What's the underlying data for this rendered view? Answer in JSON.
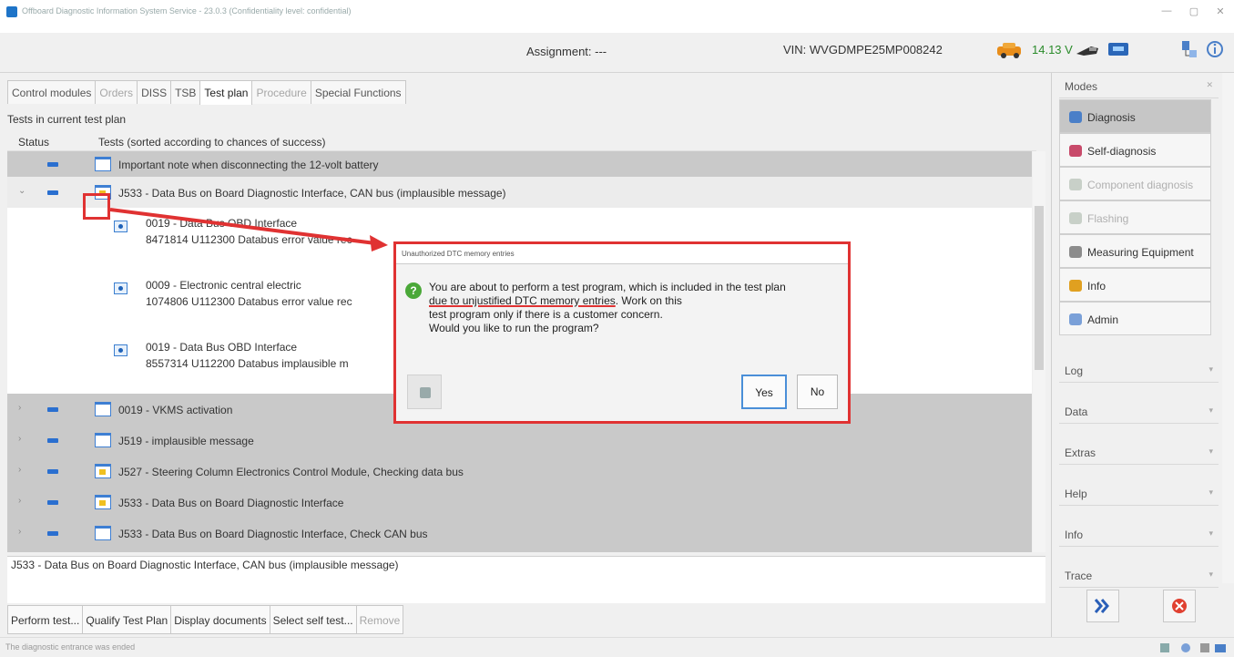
{
  "window": {
    "title": "Offboard Diagnostic Information System Service - 23.0.3 (Confidentiality level: confidential)",
    "minimize": "—",
    "maximize": "▢",
    "close": "✕"
  },
  "infobar": {
    "assignment": "Assignment: ---",
    "vin": "VIN: WVGDMPE25MP008242",
    "voltage": "14.13 V"
  },
  "tabs": [
    {
      "label": "Control modules",
      "state": "normal"
    },
    {
      "label": "Orders",
      "state": "dim"
    },
    {
      "label": "DISS",
      "state": "normal"
    },
    {
      "label": "TSB",
      "state": "normal"
    },
    {
      "label": "Test plan",
      "state": "active"
    },
    {
      "label": "Procedure",
      "state": "dim"
    },
    {
      "label": "Special Functions",
      "state": "normal"
    }
  ],
  "testplan": {
    "section_title": "Tests in current test plan",
    "col_status": "Status",
    "col_tests": "Tests (sorted according to chances of success)",
    "rows": [
      {
        "label": "Important note when disconnecting the 12-volt battery"
      },
      {
        "label": "J533 - Data Bus on Board Diagnostic Interface, CAN bus (implausible message)"
      },
      {
        "label": "0019 - VKMS activation"
      },
      {
        "label": "J519 - implausible message"
      },
      {
        "label": "J527 - Steering Column Electronics Control Module, Checking data bus"
      },
      {
        "label": "J533 - Data Bus on Board Diagnostic Interface"
      },
      {
        "label": "J533 - Data Bus on Board Diagnostic Interface, Check CAN bus"
      }
    ],
    "subrows": [
      {
        "line1": "0019 - Data Bus OBD Interface",
        "line2": "8471814  U112300  Databus error value rec"
      },
      {
        "line1": "0009 - Electronic central electric",
        "line2": "1074806  U112300  Databus error value rec"
      },
      {
        "line1": "0019 - Data Bus OBD Interface",
        "line2": "8557314  U112200  Databus implausible m"
      }
    ],
    "description": "J533 - Data Bus on Board Diagnostic Interface, CAN bus (implausible message)"
  },
  "buttons": {
    "perform": "Perform test...",
    "qualify": "Qualify Test Plan",
    "display": "Display documents",
    "select": "Select self test...",
    "remove": "Remove"
  },
  "status_text": "The diagnostic entrance was ended",
  "sidebar": {
    "modes_title": "Modes",
    "modes": [
      {
        "label": "Diagnosis",
        "state": "selected"
      },
      {
        "label": "Self-diagnosis",
        "state": "normal"
      },
      {
        "label": "Component diagnosis",
        "state": "dim"
      },
      {
        "label": "Flashing",
        "state": "dim"
      },
      {
        "label": "Measuring Equipment",
        "state": "normal"
      },
      {
        "label": "Info",
        "state": "normal"
      },
      {
        "label": "Admin",
        "state": "normal"
      }
    ],
    "panels": [
      "Log",
      "Data",
      "Extras",
      "Help",
      "Info",
      "Trace"
    ]
  },
  "dialog": {
    "title": "Unauthorized DTC memory entries",
    "msg_line1": "You are about to perform a test program, which is included in the test plan",
    "msg_underlined": "due to unjustified DTC memory entries",
    "msg_after": ". Work on this",
    "msg_line3": "test program only if there is a customer concern.",
    "msg_line4": "Would you like to run the program?",
    "yes": "Yes",
    "no": "No"
  },
  "colors": {
    "highlight_red": "#e03232",
    "status_blue": "#2a6fd0",
    "voltage_green": "#2a8b2a"
  }
}
